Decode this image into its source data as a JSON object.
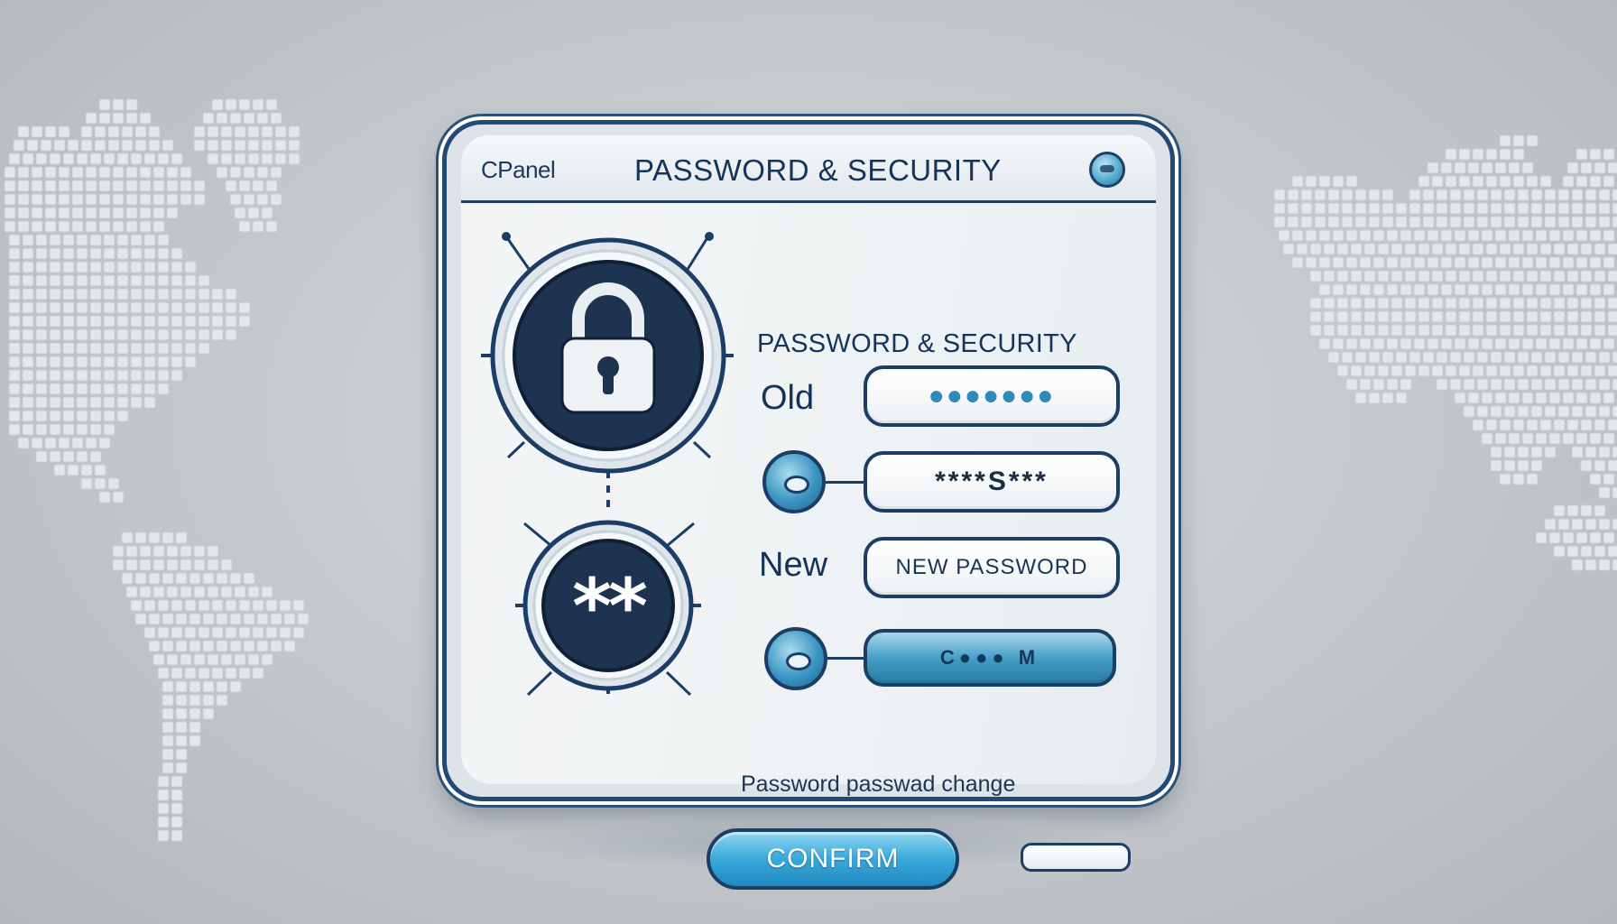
{
  "window": {
    "brand": "CPanel",
    "title": "PASSWORD & SECURITY"
  },
  "form": {
    "section_title": "PASSWORD & SECURITY",
    "old_label": "Old",
    "old_value": "●●●●●●●",
    "second_value": "****S***",
    "new_label": "New",
    "new_value": "NEW PASSWORD",
    "confirm_field_value": "C●●● M",
    "note": "Password passwad change",
    "confirm_button": "CONFIRM"
  },
  "icons": {
    "lock": "lock-icon",
    "asterisks": "asterisks-icon",
    "asterisks_text": "**"
  },
  "colors": {
    "navy": "#1c3d66",
    "accent_blue": "#39a9dc"
  }
}
